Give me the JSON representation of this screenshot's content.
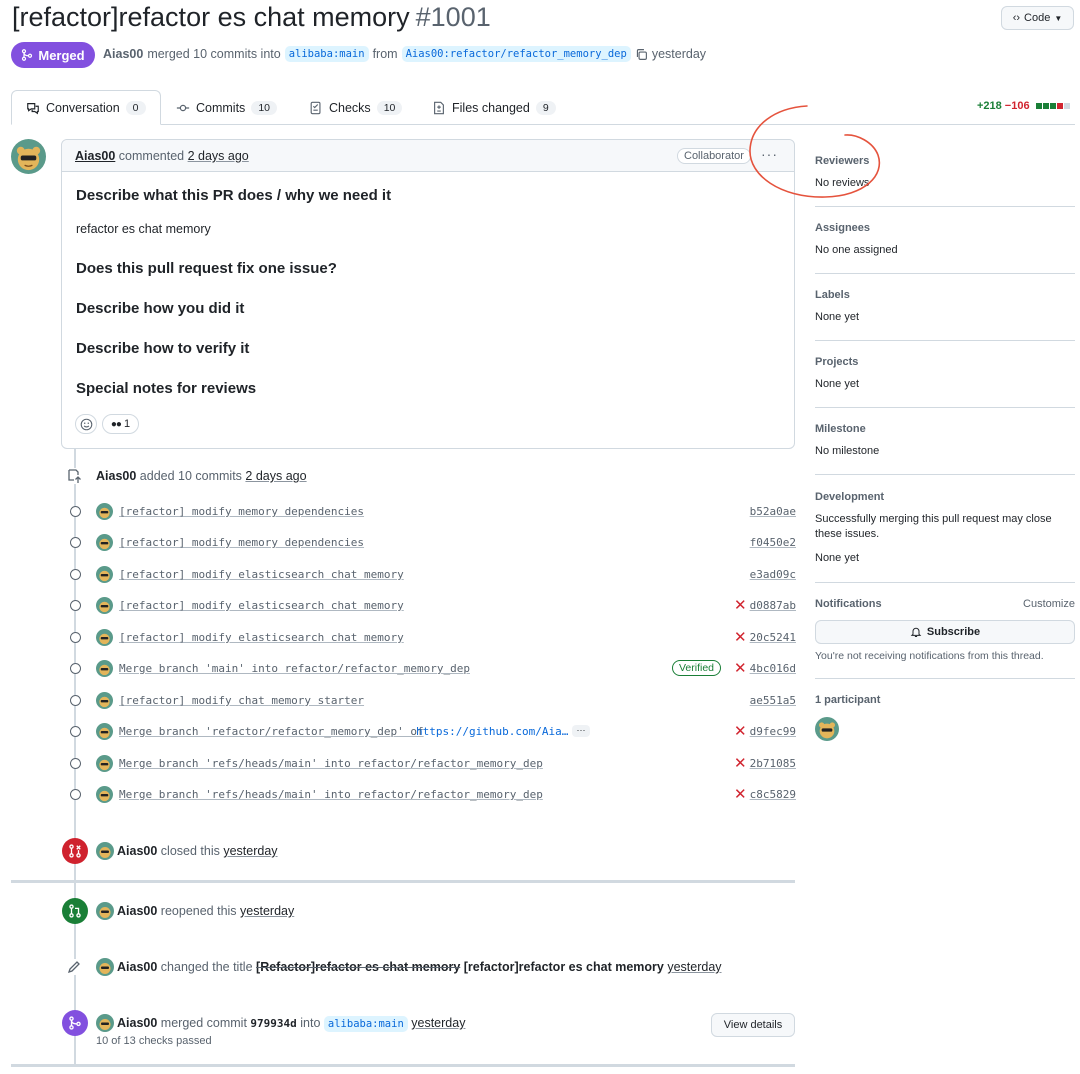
{
  "pr": {
    "title": "[refactor]refactor es chat memory",
    "number": "#1001",
    "state": "Merged",
    "author": "Aias00",
    "merged_text": "merged 10 commits into",
    "base_branch": "alibaba:main",
    "from_text": "from",
    "head_branch": "Aias00:refactor/refactor_memory_dep",
    "when": "yesterday"
  },
  "code_button": "Code",
  "tabs": [
    {
      "label": "Conversation",
      "count": "0"
    },
    {
      "label": "Commits",
      "count": "10"
    },
    {
      "label": "Checks",
      "count": "10"
    },
    {
      "label": "Files changed",
      "count": "9"
    }
  ],
  "diffstat": {
    "additions": "+218",
    "deletions": "−106"
  },
  "comment": {
    "author": "Aias00",
    "action": "commented",
    "when": "2 days ago",
    "role": "Collaborator",
    "h1": "Describe what this PR does / why we need it",
    "p1": "refactor es chat memory",
    "h2": "Does this pull request fix one issue?",
    "h3": "Describe how you did it",
    "h4": "Describe how to verify it",
    "h5": "Special notes for reviews",
    "reaction_count": "1"
  },
  "commits_event": {
    "author": "Aias00",
    "text": "added 10 commits",
    "when": "2 days ago"
  },
  "commits": [
    {
      "message": "[refactor] modify memory dependencies",
      "sha": "b52a0ae",
      "status": "",
      "verified": ""
    },
    {
      "message": "[refactor] modify memory dependencies",
      "sha": "f0450e2",
      "status": "",
      "verified": ""
    },
    {
      "message": "[refactor] modify elasticsearch chat memory",
      "sha": "e3ad09c",
      "status": "",
      "verified": ""
    },
    {
      "message": "[refactor] modify elasticsearch chat memory",
      "sha": "d0887ab",
      "status": "fail",
      "verified": ""
    },
    {
      "message": "[refactor] modify elasticsearch chat memory",
      "sha": "20c5241",
      "status": "fail",
      "verified": ""
    },
    {
      "message": "Merge branch 'main' into refactor/refactor_memory_dep",
      "sha": "4bc016d",
      "status": "fail",
      "verified": "Verified"
    },
    {
      "message": "[refactor] modify chat memory starter",
      "sha": "ae551a5",
      "status": "",
      "verified": ""
    },
    {
      "message": "Merge branch 'refactor/refactor_memory_dep' of",
      "link": "https://github.com/Aia…",
      "sha": "d9fec99",
      "status": "fail",
      "verified": ""
    },
    {
      "message": "Merge branch 'refs/heads/main' into refactor/refactor_memory_dep",
      "sha": "2b71085",
      "status": "fail",
      "verified": ""
    },
    {
      "message": "Merge branch 'refs/heads/main' into refactor/refactor_memory_dep",
      "sha": "c8c5829",
      "status": "fail",
      "verified": ""
    }
  ],
  "events": {
    "closed": {
      "author": "Aias00",
      "text": "closed this",
      "when": "yesterday"
    },
    "reopened": {
      "author": "Aias00",
      "text": "reopened this",
      "when": "yesterday"
    },
    "renamed": {
      "author": "Aias00",
      "text": "changed the title",
      "old": "[Refactor]refactor es chat memory",
      "new": "[refactor]refactor es chat memory",
      "when": "yesterday"
    },
    "merged": {
      "author": "Aias00",
      "text": "merged commit",
      "commit": "979934d",
      "into": "into",
      "branch": "alibaba:main",
      "when": "yesterday",
      "checks": "10 of 13 checks passed",
      "button": "View details"
    }
  },
  "sidebar": {
    "reviewers": {
      "label": "Reviewers",
      "value": "No reviews"
    },
    "assignees": {
      "label": "Assignees",
      "value": "No one assigned"
    },
    "labels": {
      "label": "Labels",
      "value": "None yet"
    },
    "projects": {
      "label": "Projects",
      "value": "None yet"
    },
    "milestone": {
      "label": "Milestone",
      "value": "No milestone"
    },
    "development": {
      "label": "Development",
      "desc": "Successfully merging this pull request may close these issues.",
      "value": "None yet"
    },
    "notifications": {
      "label": "Notifications",
      "customize": "Customize",
      "button": "Subscribe",
      "note": "You're not receiving notifications from this thread."
    },
    "participants": {
      "label": "1 participant"
    }
  },
  "colors": {
    "merged": "#8250df",
    "closed": "#cf222e",
    "reopened": "#1a7f37",
    "link": "#0969da",
    "annotation": "#e5533d"
  }
}
